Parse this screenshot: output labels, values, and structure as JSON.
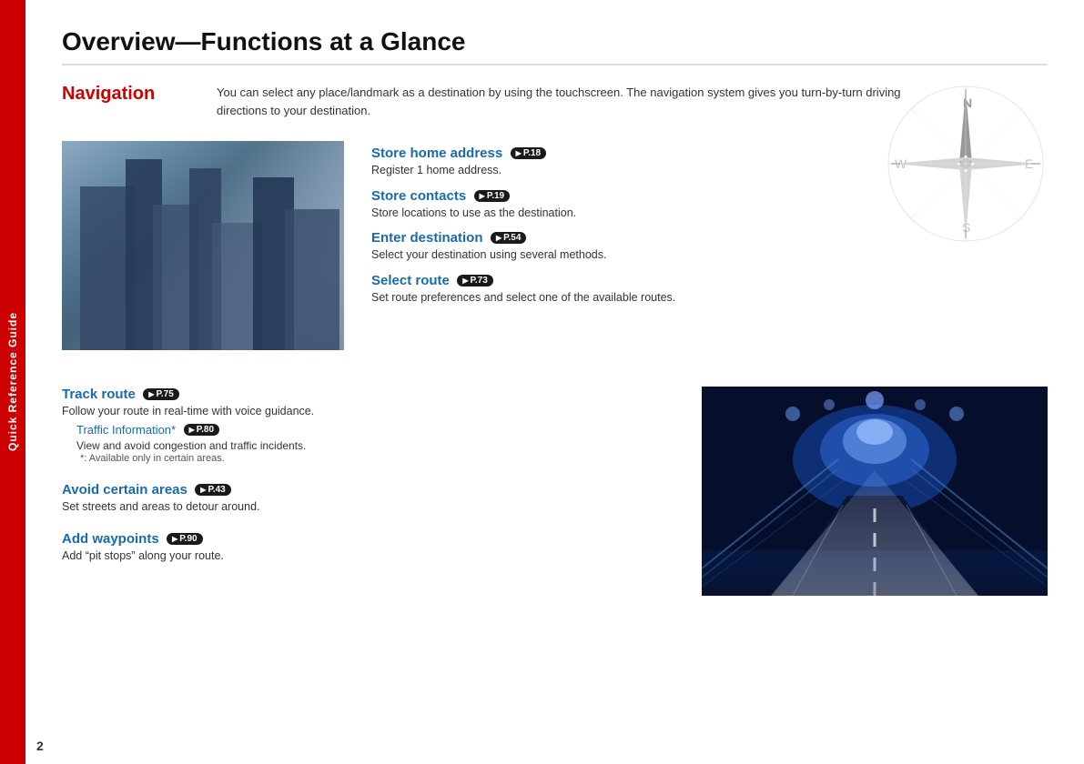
{
  "sidebar": {
    "label": "Quick Reference Guide"
  },
  "page": {
    "title": "Overview—Functions at a Glance",
    "number": "2"
  },
  "navigation": {
    "heading": "Navigation",
    "intro": "You can select any place/landmark as a destination by using the touchscreen. The navigation system gives you turn-by-turn driving directions to your destination.",
    "features": [
      {
        "title": "Store home address",
        "badge": "P.18",
        "description": "Register 1 home address."
      },
      {
        "title": "Store contacts",
        "badge": "P.19",
        "description": "Store locations to use as the destination."
      },
      {
        "title": "Enter destination",
        "badge": "P.54",
        "description": "Select your destination using several methods."
      },
      {
        "title": "Select route",
        "badge": "P.73",
        "description": "Set route preferences and select one of the available routes."
      }
    ],
    "bottom_features": [
      {
        "title": "Track route",
        "badge": "P.75",
        "description": "Follow your route in real-time with voice guidance.",
        "sub": {
          "title": "Traffic Information*",
          "badge": "P.80",
          "description": "View and avoid congestion and traffic incidents.",
          "footnote": "*: Available only in certain areas."
        }
      },
      {
        "title": "Avoid certain areas",
        "badge": "P.43",
        "description": "Set streets and areas to detour around."
      },
      {
        "title": "Add waypoints",
        "badge": "P.90",
        "description": "Add “pit stops” along your route."
      }
    ]
  }
}
